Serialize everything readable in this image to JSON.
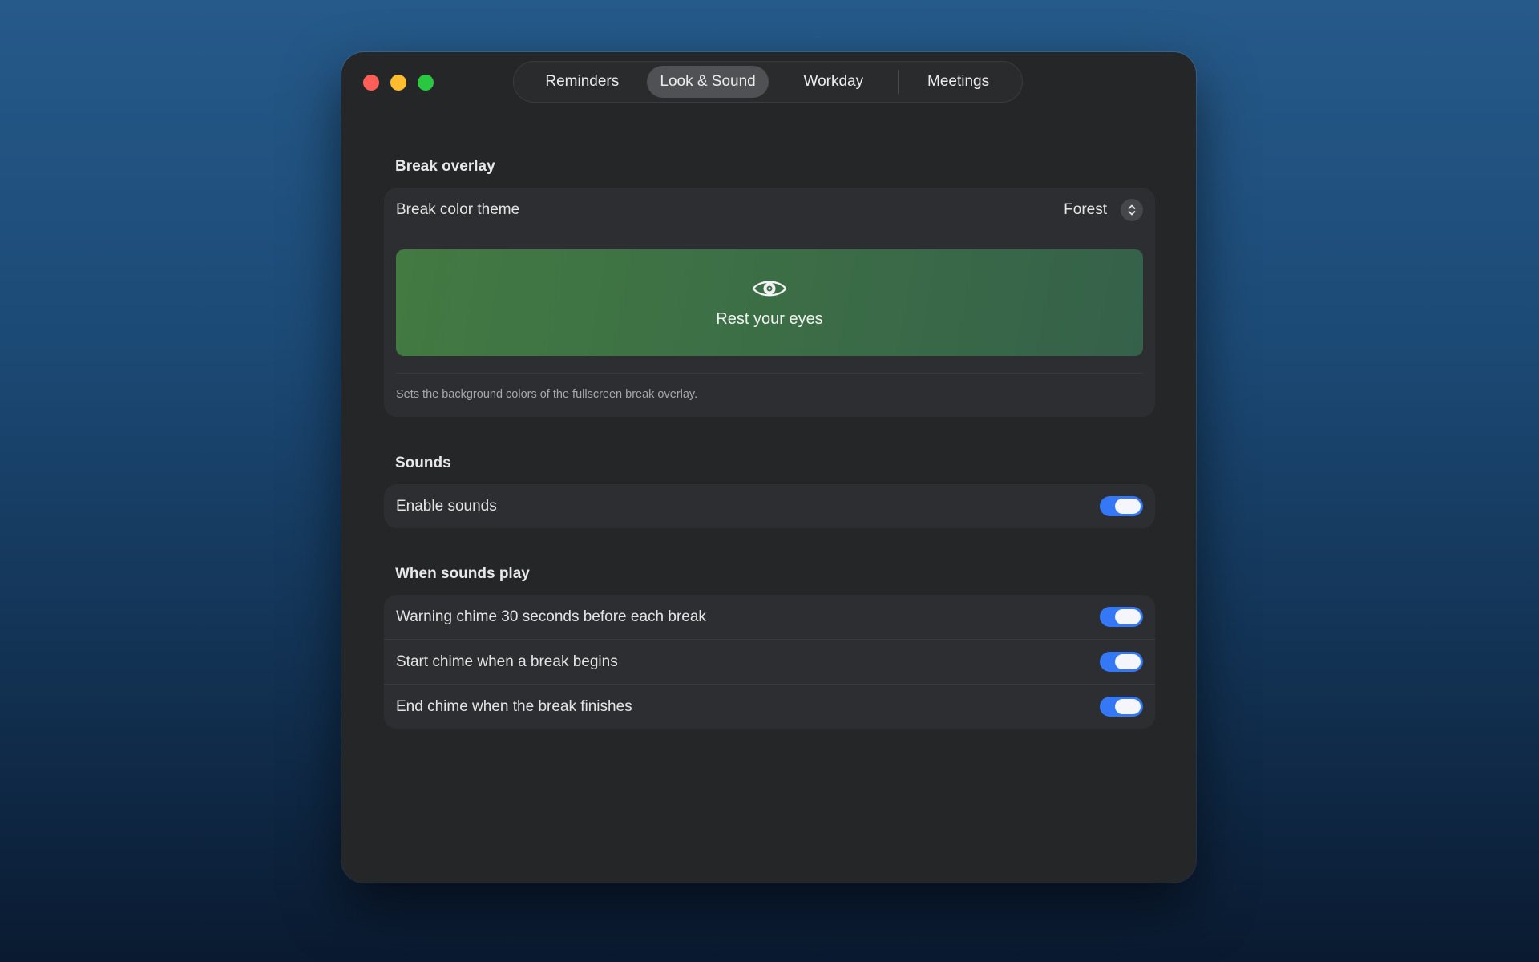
{
  "window": {
    "traffic_lights": [
      {
        "name": "close",
        "color": "#ff5f57"
      },
      {
        "name": "minimize",
        "color": "#febc2e"
      },
      {
        "name": "zoom",
        "color": "#28c840"
      }
    ]
  },
  "tabs": [
    {
      "label": "Reminders",
      "active": false
    },
    {
      "label": "Look & Sound",
      "active": true
    },
    {
      "label": "Workday",
      "active": false
    },
    {
      "label": "Meetings",
      "active": false
    }
  ],
  "break_overlay": {
    "section_title": "Break overlay",
    "theme_label": "Break color theme",
    "theme_value": "Forest",
    "preview_icon": "eye-icon",
    "preview_text": "Rest your eyes",
    "preview_colors": [
      "#427a42",
      "#35614a"
    ],
    "footnote": "Sets the background colors of the fullscreen break overlay."
  },
  "sounds": {
    "section_title": "Sounds",
    "enable_label": "Enable sounds",
    "enable_on": true
  },
  "when_sounds_play": {
    "section_title": "When sounds play",
    "items": [
      {
        "label": "Warning chime 30 seconds before each break",
        "on": true
      },
      {
        "label": "Start chime when a break begins",
        "on": true
      },
      {
        "label": "End chime when the break finishes",
        "on": true
      }
    ]
  },
  "colors": {
    "accent": "#3478f6",
    "window_bg": "#252628",
    "card_bg": "#2d2e31"
  }
}
